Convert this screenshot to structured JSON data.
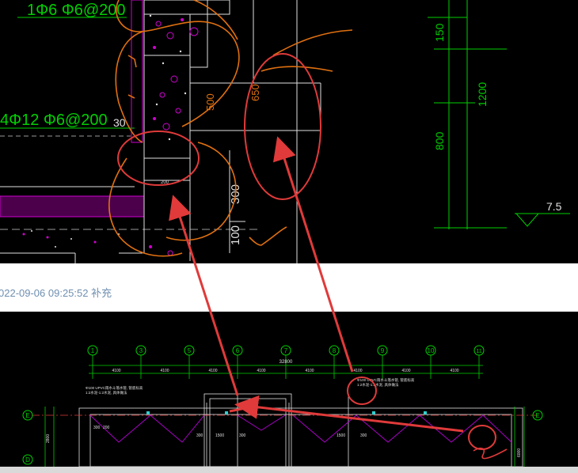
{
  "colors": {
    "cad_background": "#000000",
    "green": "#00d000",
    "magenta": "#d000d0",
    "orange": "#e07010",
    "red": "#e03a3a",
    "white": "#e0e0e0",
    "caption_text": "#6f8fb0"
  },
  "top_drawing": {
    "rebar_label_1": "1Φ6  Φ6@200",
    "rebar_label_2": "4Φ12  Φ6@200",
    "dim_30": "30",
    "dim_500": "500",
    "dim_650": "650",
    "dim_300": "300",
    "dim_100": "100",
    "dim_200": "200",
    "dim_150": "150",
    "dim_1200": "1200",
    "dim_800": "800",
    "elevation": "7.5"
  },
  "caption": {
    "text": "022-09-06 09:25:52 补充"
  },
  "bottom_drawing": {
    "axis_labels": [
      "1",
      "3",
      "5",
      "6",
      "7",
      "8",
      "9",
      "10",
      "11"
    ],
    "row_label_e_left": "E",
    "row_label_d_left": "D",
    "row_label_e_right": "E",
    "total_dim": "32800",
    "span_dims": [
      "4100",
      "4100",
      "4100",
      "4100",
      "4100",
      "4100",
      "4100",
      "4100"
    ],
    "note_left_1": "Φ100 UPVC雨水斗落水管, 管底标高",
    "note_left_2": "1:2水泥-1:2水泥, 具体做法",
    "note_right_1": "Φ100 UPVC雨水斗落水管, 管底标高",
    "note_right_2": "1:2水泥-1:2水泥, 具体做法",
    "small_dims": [
      "200",
      "300",
      "300",
      "1500",
      "300",
      "1500",
      "300"
    ],
    "left_vertical_dim": "2800",
    "right_vertical_dim": "6000"
  }
}
